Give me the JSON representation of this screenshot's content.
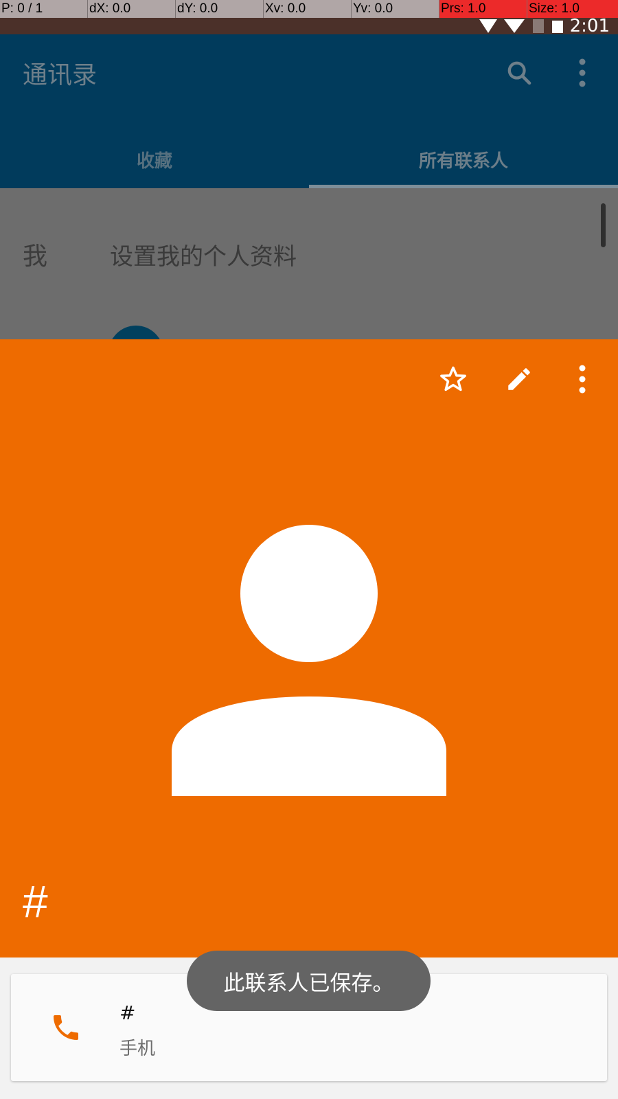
{
  "debug": {
    "pointer": "P: 0 / 1",
    "dx": "dX: 0.0",
    "dy": "dY: 0.0",
    "xv": "Xv: 0.0",
    "yv": "Yv: 0.0",
    "prs": "Prs: 1.0",
    "size": "Size: 1.0"
  },
  "status": {
    "time": "2:01"
  },
  "app_bar": {
    "title": "通讯录",
    "tabs": [
      {
        "label": "收藏",
        "active": false
      },
      {
        "label": "所有联系人",
        "active": true
      }
    ]
  },
  "list": {
    "me_label": "我",
    "me_text": "设置我的个人资料"
  },
  "quick_contact": {
    "header_color": "#ee6b00",
    "name": "#",
    "actions": [
      "star-icon",
      "edit-icon",
      "more-vert-icon"
    ],
    "phone": {
      "value": "#",
      "type": "手机"
    }
  },
  "toast": {
    "message": "此联系人已保存。"
  },
  "colors": {
    "app_bar": "#013b5c",
    "status_bar": "#4b3029",
    "accent": "#ee6b00"
  }
}
